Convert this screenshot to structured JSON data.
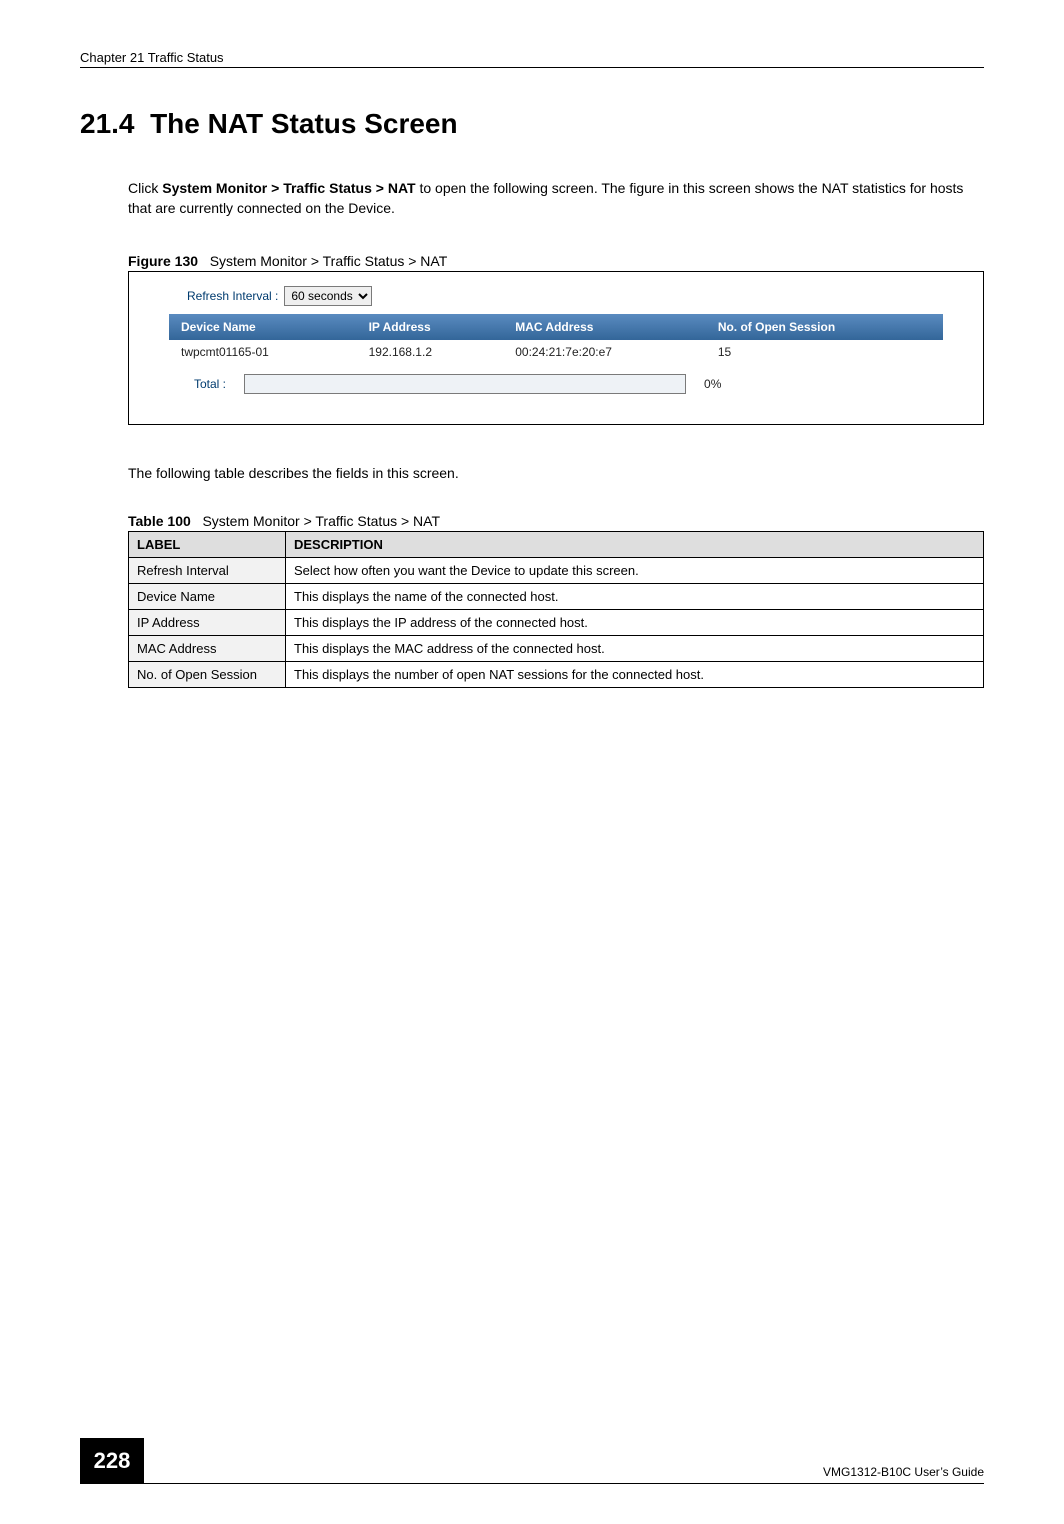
{
  "header": {
    "chapter": "Chapter 21 Traffic Status"
  },
  "section": {
    "number": "21.4",
    "title": "The NAT Status Screen"
  },
  "intro": {
    "pre": "Click ",
    "path": "System Monitor > Traffic Status > NAT",
    "post": " to open the following screen. The figure in this screen shows the NAT statistics for hosts that are currently connected on the Device."
  },
  "figure_caption": {
    "label": "Figure 130",
    "text": "System Monitor > Traffic Status > NAT"
  },
  "figure": {
    "refresh_label": "Refresh Interval :",
    "refresh_value": "60 seconds",
    "headers": {
      "device_name": "Device Name",
      "ip_address": "IP Address",
      "mac_address": "MAC Address",
      "open_sessions": "No. of Open Session"
    },
    "rows": [
      {
        "device_name": "twpcmt01165-01",
        "ip_address": "192.168.1.2",
        "mac_address": "00:24:21:7e:20:e7",
        "open_sessions": "15"
      }
    ],
    "total_label": "Total :",
    "total_pct": "0%"
  },
  "after_figure": "The following table describes the fields in this screen.",
  "table_caption": {
    "label": "Table 100",
    "text": "System Monitor > Traffic Status > NAT"
  },
  "doc_table": {
    "header_label": "LABEL",
    "header_desc": "DESCRIPTION",
    "rows": [
      {
        "label": "Refresh Interval",
        "desc": "Select how often you want the Device to update this screen."
      },
      {
        "label": "Device Name",
        "desc": "This displays the name of the connected host."
      },
      {
        "label": "IP Address",
        "desc": "This displays the IP address of the connected host."
      },
      {
        "label": "MAC Address",
        "desc": "This displays the MAC address of the connected host."
      },
      {
        "label": "No. of Open Session",
        "desc": "This displays the number of open NAT sessions for the connected host."
      }
    ]
  },
  "footer": {
    "page": "228",
    "guide": "VMG1312-B10C User’s Guide"
  }
}
